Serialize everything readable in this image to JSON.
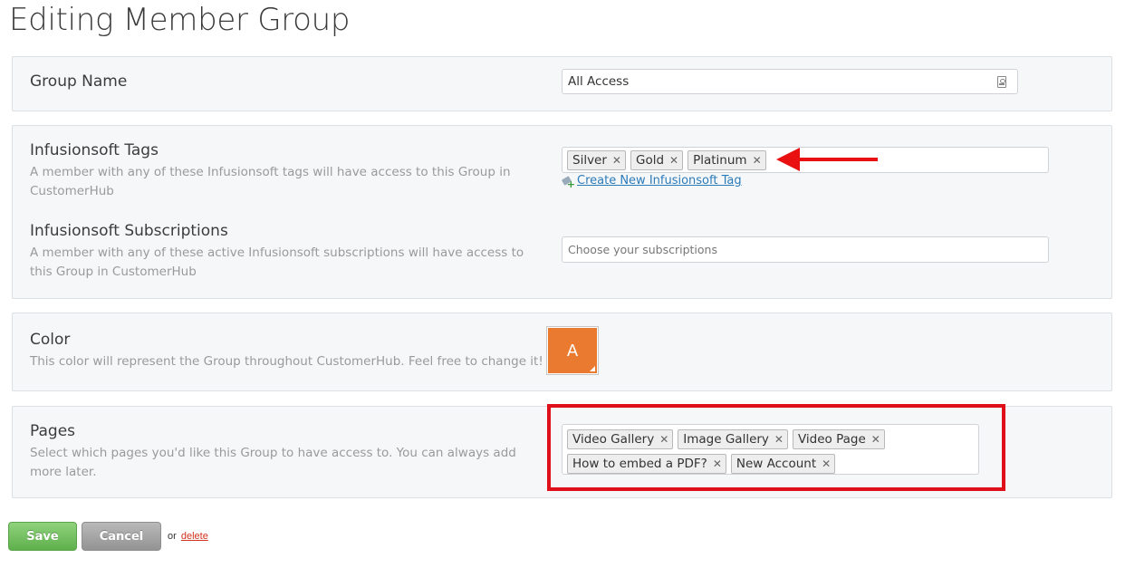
{
  "page": {
    "title": "Editing Member Group"
  },
  "group_name": {
    "label": "Group Name",
    "value": "All Access",
    "icon": "contact-card-icon"
  },
  "tags": {
    "label": "Infusionsoft Tags",
    "description": "A member with any of these Infusionsoft tags will have access to this Group in CustomerHub",
    "items": [
      "Silver",
      "Gold",
      "Platinum"
    ],
    "remove_glyph": "✕",
    "create_link": "Create New Infusionsoft Tag",
    "create_icon": "tag-add-icon"
  },
  "subscriptions": {
    "label": "Infusionsoft Subscriptions",
    "description": "A member with any of these active Infusionsoft subscriptions will have access to this Group in CustomerHub",
    "placeholder": "Choose your subscriptions"
  },
  "color": {
    "label": "Color",
    "description": "This color will represent the Group throughout CustomerHub. Feel free to change it!",
    "swatch_letter": "A",
    "swatch_color": "#ea7a30"
  },
  "pages": {
    "label": "Pages",
    "description": "Select which pages you'd like this Group to have access to. You can always add more later.",
    "items": [
      "Video Gallery",
      "Image Gallery",
      "Video Page",
      "How to embed a PDF?",
      "New Account"
    ]
  },
  "annotations": {
    "arrow_color": "#e81010",
    "highlight_color": "#e0101a"
  },
  "actions": {
    "save": "Save",
    "cancel": "Cancel",
    "or": "or",
    "delete": "delete"
  }
}
